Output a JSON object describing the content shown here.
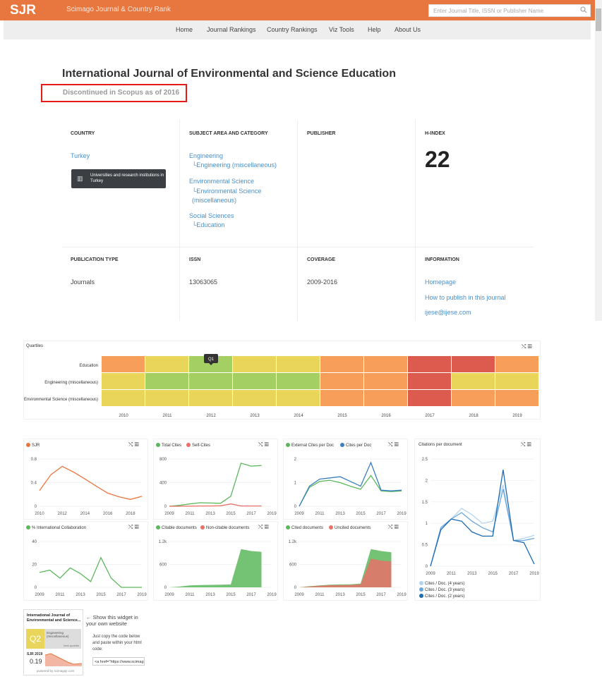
{
  "header": {
    "logo": "SJR",
    "site_name": "Scimago Journal & Country Rank",
    "search_placeholder": "Enter Journal Title, ISSN or Publisher Name"
  },
  "nav": [
    "Home",
    "Journal Rankings",
    "Country Rankings",
    "Viz Tools",
    "Help",
    "About Us"
  ],
  "journal": {
    "title": "International Journal of Environmental and Science Education",
    "status": "Discontinued in Scopus as of 2016"
  },
  "info": {
    "country_label": "COUNTRY",
    "country": "Turkey",
    "institutions_button": "Universities and research institutions in Turkey",
    "subject_label": "SUBJECT AREA AND CATEGORY",
    "subjects": [
      {
        "area": "Engineering",
        "cats": [
          "Engineering (miscellaneous)"
        ]
      },
      {
        "area": "Environmental Science",
        "cats": [
          "Environmental Science (miscellaneous)"
        ]
      },
      {
        "area": "Social Sciences",
        "cats": [
          "Education"
        ]
      }
    ],
    "publisher_label": "PUBLISHER",
    "hindex_label": "H-INDEX",
    "hindex": "22",
    "pubtype_label": "PUBLICATION TYPE",
    "pubtype": "Journals",
    "issn_label": "ISSN",
    "issn": "13063065",
    "coverage_label": "COVERAGE",
    "coverage": "2009-2016",
    "information_label": "INFORMATION",
    "homepage": "Homepage",
    "how_to_publish": "How to publish in this journal",
    "email": "ijese@ijese.com"
  },
  "quartiles": {
    "title": "Quartiles",
    "tooltip": "Q1",
    "years": [
      "2010",
      "2011",
      "2012",
      "2013",
      "2014",
      "2015",
      "2016",
      "2017",
      "2018",
      "2019"
    ],
    "rows": [
      {
        "name": "Education",
        "q": [
          "Q3",
          "Q2",
          "Q1",
          "Q2",
          "Q2",
          "Q3",
          "Q3",
          "Q4",
          "Q4",
          "Q3"
        ]
      },
      {
        "name": "Engineering (miscellaneous)",
        "q": [
          "Q2",
          "Q1",
          "Q1",
          "Q1",
          "Q1",
          "Q3",
          "Q3",
          "Q4",
          "Q2",
          "Q2"
        ]
      },
      {
        "name": "Environmental Science (miscellaneous)",
        "q": [
          "Q2",
          "Q2",
          "Q2",
          "Q2",
          "Q2",
          "Q3",
          "Q3",
          "Q4",
          "Q3",
          "Q3"
        ]
      }
    ],
    "colors": {
      "Q1": "#a4cf63",
      "Q2": "#e8d559",
      "Q3": "#f79e5b",
      "Q4": "#dd5a4e"
    }
  },
  "chart_data": [
    {
      "type": "line",
      "id": "sjr",
      "series": [
        {
          "name": "SJR",
          "color": "#e8763f",
          "x": [
            2010,
            2011,
            2012,
            2013,
            2014,
            2015,
            2016,
            2017,
            2018,
            2019
          ],
          "values": [
            0.3,
            0.6,
            0.76,
            0.65,
            0.52,
            0.38,
            0.25,
            0.18,
            0.13,
            0.19
          ]
        }
      ],
      "xticks": [
        "2010",
        "2012",
        "2014",
        "2016",
        "2018"
      ],
      "yticks": [
        "0",
        "0.4",
        "0.8"
      ],
      "ylim": [
        0,
        0.9
      ]
    },
    {
      "type": "line",
      "id": "cites",
      "series": [
        {
          "name": "Total Cites",
          "color": "#5cb85c",
          "x": [
            2009,
            2010,
            2011,
            2012,
            2013,
            2014,
            2015,
            2016,
            2017,
            2018,
            2019
          ],
          "values": [
            0,
            15,
            40,
            60,
            55,
            50,
            170,
            730,
            680,
            690,
            null
          ]
        },
        {
          "name": "Self-Cites",
          "color": "#e8716a",
          "x": [
            2009,
            2010,
            2011,
            2012,
            2013,
            2014,
            2015,
            2016,
            2017,
            2018,
            2019
          ],
          "values": [
            0,
            0,
            2,
            5,
            5,
            8,
            40,
            5,
            5,
            5,
            null
          ]
        }
      ],
      "xticks": [
        "2009",
        "2011",
        "2013",
        "2015",
        "2017",
        "2019"
      ],
      "yticks": [
        "0",
        "400",
        "800"
      ],
      "ylim": [
        0,
        800
      ]
    },
    {
      "type": "line",
      "id": "cpd",
      "series": [
        {
          "name": "External Cites per Doc",
          "color": "#5cb85c",
          "x": [
            2009,
            2010,
            2011,
            2012,
            2013,
            2014,
            2015,
            2016,
            2017,
            2018,
            2019
          ],
          "values": [
            0,
            0.8,
            1.05,
            1.1,
            1.0,
            0.85,
            0.72,
            1.3,
            0.65,
            0.62,
            0.65
          ]
        },
        {
          "name": "Cites per Doc",
          "color": "#3a7fc0",
          "x": [
            2009,
            2010,
            2011,
            2012,
            2013,
            2014,
            2015,
            2016,
            2017,
            2018,
            2019
          ],
          "values": [
            0,
            0.85,
            1.15,
            1.2,
            1.25,
            1.05,
            0.85,
            1.85,
            0.68,
            0.65,
            0.68
          ]
        }
      ],
      "xticks": [
        "2009",
        "2011",
        "2013",
        "2015",
        "2017",
        "2019"
      ],
      "yticks": [
        "0",
        "1",
        "2"
      ],
      "ylim": [
        0,
        2
      ]
    },
    {
      "type": "line",
      "id": "collab",
      "series": [
        {
          "name": "% International Collaboration",
          "color": "#5cb85c",
          "x": [
            2009,
            2010,
            2011,
            2012,
            2013,
            2014,
            2015,
            2016,
            2017,
            2018,
            2019
          ],
          "values": [
            13,
            15,
            8,
            17,
            12,
            5,
            26,
            8,
            0,
            0,
            0
          ]
        }
      ],
      "xticks": [
        "2009",
        "2011",
        "2013",
        "2015",
        "2017",
        "2019"
      ],
      "yticks": [
        "0",
        "20",
        "40"
      ],
      "ylim": [
        0,
        40
      ]
    },
    {
      "type": "area",
      "id": "citable",
      "series": [
        {
          "name": "Citable documents",
          "color": "#5cb85c",
          "x": [
            2009,
            2010,
            2011,
            2012,
            2013,
            2014,
            2015,
            2016,
            2017,
            2018,
            2019
          ],
          "values": [
            0,
            20,
            50,
            60,
            65,
            70,
            75,
            1000,
            950,
            930,
            null
          ]
        },
        {
          "name": "Non-citable documents",
          "color": "#e8716a",
          "x": [
            2009,
            2010,
            2011,
            2012,
            2013,
            2014,
            2015,
            2016,
            2017,
            2018,
            2019
          ],
          "values": [
            0,
            0,
            0,
            0,
            0,
            0,
            0,
            0,
            0,
            0,
            null
          ]
        }
      ],
      "xticks": [
        "2009",
        "2011",
        "2013",
        "2015",
        "2017",
        "2019"
      ],
      "yticks": [
        "0",
        "600",
        "1.2k"
      ],
      "ylim": [
        0,
        1200
      ]
    },
    {
      "type": "area",
      "id": "cited",
      "series": [
        {
          "name": "Cited documents",
          "color": "#5cb85c",
          "x": [
            2009,
            2010,
            2011,
            2012,
            2013,
            2014,
            2015,
            2016,
            2017,
            2018,
            2019
          ],
          "values": [
            0,
            30,
            50,
            70,
            75,
            80,
            100,
            1000,
            950,
            920,
            null
          ]
        },
        {
          "name": "Uncited documents",
          "color": "#e8716a",
          "x": [
            2009,
            2010,
            2011,
            2012,
            2013,
            2014,
            2015,
            2016,
            2017,
            2018,
            2019
          ],
          "values": [
            0,
            20,
            40,
            55,
            60,
            65,
            80,
            750,
            700,
            680,
            null
          ]
        }
      ],
      "xticks": [
        "2009",
        "2011",
        "2013",
        "2015",
        "2017",
        "2019"
      ],
      "yticks": [
        "0",
        "600",
        "1.2k"
      ],
      "ylim": [
        0,
        1200
      ]
    },
    {
      "type": "line",
      "id": "citesdoc",
      "title": "Citations per document",
      "series": [
        {
          "name": "Cites / Doc. (4 years)",
          "color": "#b3d4ef",
          "x": [
            2009,
            2010,
            2011,
            2012,
            2013,
            2014,
            2015,
            2016,
            2017,
            2018,
            2019
          ],
          "values": [
            0,
            0.9,
            1.1,
            1.35,
            1.2,
            1.0,
            1.05,
            1.9,
            0.6,
            0.65,
            0.72
          ]
        },
        {
          "name": "Cites / Doc. (3 years)",
          "color": "#6aa6d8",
          "x": [
            2009,
            2010,
            2011,
            2012,
            2013,
            2014,
            2015,
            2016,
            2017,
            2018,
            2019
          ],
          "values": [
            0,
            0.9,
            1.1,
            1.25,
            1.05,
            0.9,
            0.8,
            1.8,
            0.6,
            0.6,
            0.65
          ]
        },
        {
          "name": "Cites / Doc. (2 years)",
          "color": "#1e6bb0",
          "x": [
            2009,
            2010,
            2011,
            2012,
            2013,
            2014,
            2015,
            2016,
            2017,
            2018,
            2019
          ],
          "values": [
            0,
            0.85,
            1.1,
            1.05,
            0.8,
            0.7,
            0.7,
            2.25,
            0.6,
            0.55,
            0.05
          ]
        }
      ],
      "xticks": [
        "2009",
        "2011",
        "2013",
        "2015",
        "2017",
        "2019"
      ],
      "yticks": [
        "0",
        "0.5",
        "1",
        "1.5",
        "2",
        "2.5"
      ],
      "ylim": [
        0,
        2.5
      ]
    }
  ],
  "widget": {
    "title": "International Journal of Environmental and Science...",
    "quartile": "Q2",
    "category": "Engineering (miscellaneous)",
    "best_quartile": "best quartile",
    "sjr_label": "SJR 2019",
    "sjr_value": "0.19",
    "powered": "powered by scimagojr.com",
    "show_text": "Show this widget in your own website",
    "copy_text": "Just copy the code below and paste within your html code:",
    "code": "<a href=\"https://www.scimag"
  }
}
